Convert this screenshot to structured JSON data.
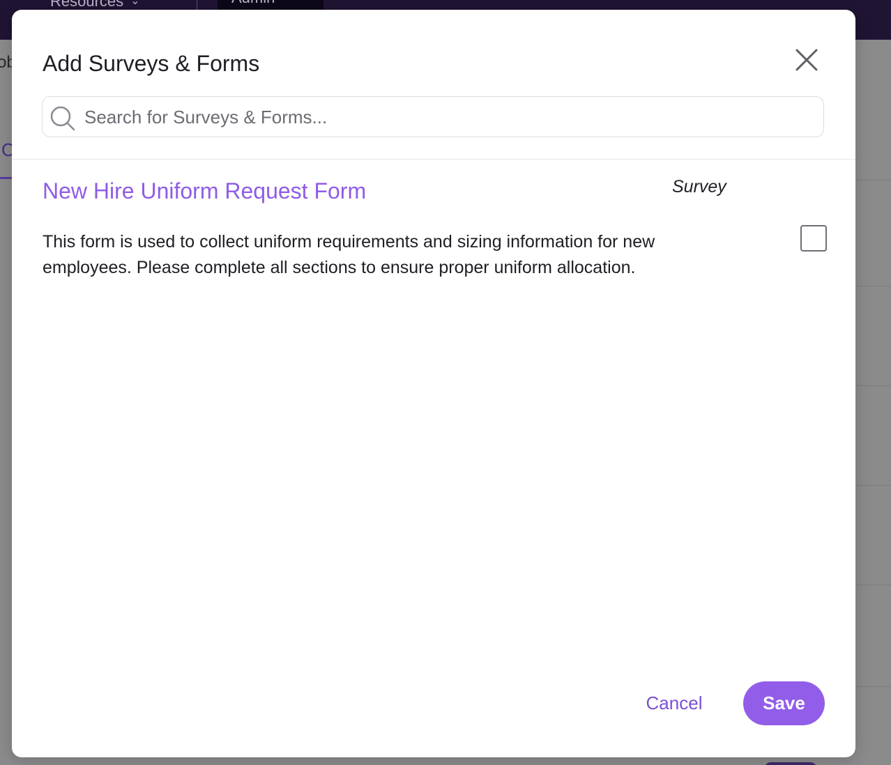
{
  "background": {
    "nav_items": [
      {
        "label": "Resources",
        "icon": "chevron-down-icon"
      },
      {
        "label": "Admin",
        "icon": "chevron-down-icon"
      }
    ],
    "partial_text_left": "ob",
    "partial_tab_text": "C"
  },
  "modal": {
    "title": "Add Surveys & Forms",
    "close_icon": "close-icon",
    "search": {
      "icon": "search-icon",
      "placeholder": "Search for Surveys & Forms...",
      "value": ""
    },
    "items": [
      {
        "title": "New Hire Uniform Request Form",
        "type": "Survey",
        "description": "This form is used to collect uniform requirements and sizing information for new employees. Please complete all sections to ensure proper uniform allocation.",
        "checked": false
      }
    ],
    "footer": {
      "cancel_label": "Cancel",
      "save_label": "Save"
    }
  },
  "colors": {
    "accent": "#925de8",
    "link": "#8f5ce6",
    "cancel_text": "#7a4fd6",
    "topbar": "#1f1433",
    "overlay": "#8b8b8c"
  }
}
